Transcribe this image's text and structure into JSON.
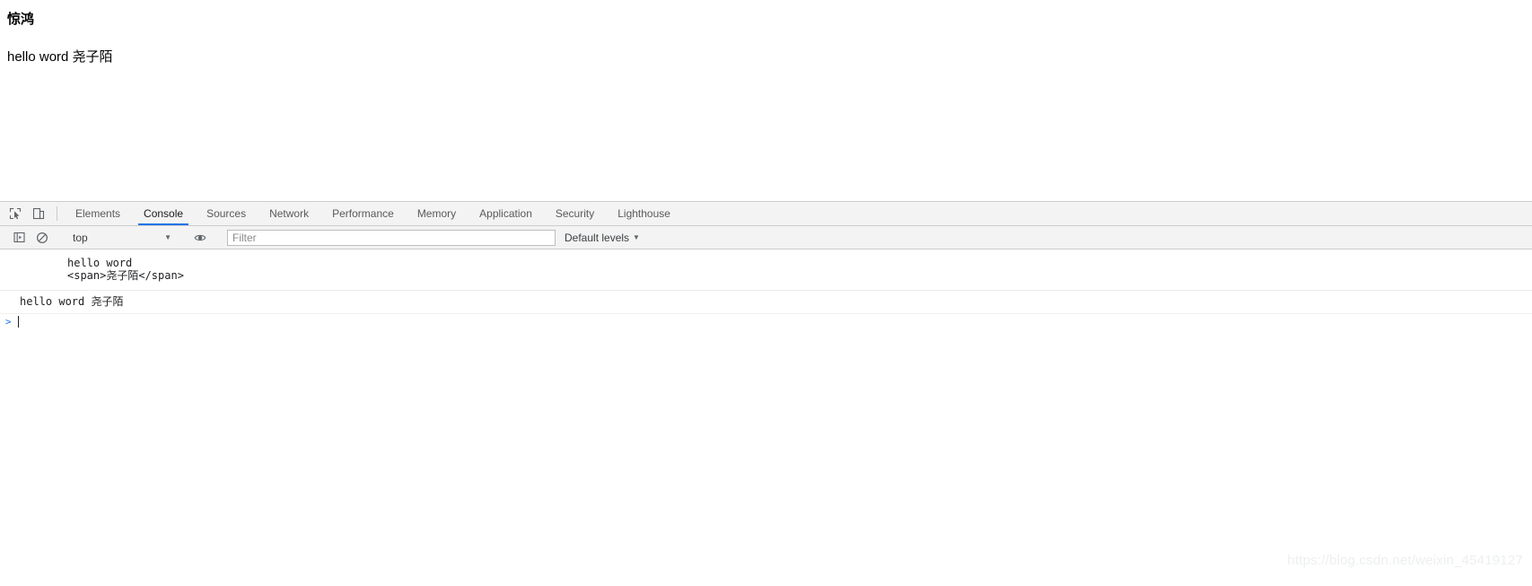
{
  "page": {
    "heading": "惊鸿",
    "paragraph": "hello word 尧子陌"
  },
  "devtools": {
    "toolbar_icons": [
      {
        "name": "inspect-element-icon",
        "title": "Inspect element"
      },
      {
        "name": "device-toolbar-icon",
        "title": "Toggle device toolbar"
      }
    ],
    "tabs": [
      {
        "label": "Elements",
        "selected": false
      },
      {
        "label": "Console",
        "selected": true
      },
      {
        "label": "Sources",
        "selected": false
      },
      {
        "label": "Network",
        "selected": false
      },
      {
        "label": "Performance",
        "selected": false
      },
      {
        "label": "Memory",
        "selected": false
      },
      {
        "label": "Application",
        "selected": false
      },
      {
        "label": "Security",
        "selected": false
      },
      {
        "label": "Lighthouse",
        "selected": false
      }
    ],
    "console_toolbar": {
      "sidebar_toggle_icon": "console-sidebar-icon",
      "clear_icon": "clear-console-icon",
      "context_value": "top",
      "context_caret": "▼",
      "eye_icon": "live-expression-eye-icon",
      "filter_value": "",
      "filter_placeholder": "Filter",
      "levels_label": "Default levels",
      "levels_caret": "▼"
    },
    "console_messages": [
      {
        "type": "log",
        "lines": [
          "hello word",
          "<span>尧子陌</span>"
        ]
      },
      {
        "type": "result",
        "lines": [
          "hello word 尧子陌"
        ]
      }
    ],
    "prompt": {
      "arrow": ">",
      "value": ""
    }
  },
  "watermark": {
    "text": "https://blog.csdn.net/weixin_45419127"
  },
  "colors": {
    "accent": "#1a73e8",
    "toolbar_bg": "#f3f3f3",
    "border": "#cdcdcd",
    "text": "#202124"
  }
}
